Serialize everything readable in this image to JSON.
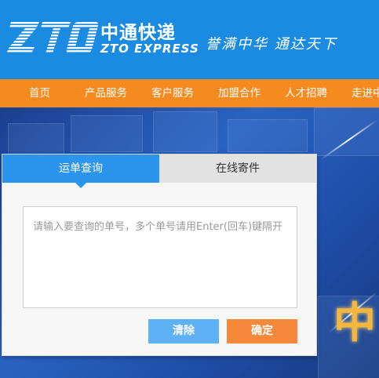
{
  "header": {
    "logo_mark": "ZTO",
    "logo_cn": "中通快递",
    "logo_en": "ZTO EXPRESS",
    "slogan": "誉满中华  通达天下",
    "bg_color": "#1a8be0"
  },
  "nav": {
    "bg_color": "#f58a1f",
    "items": [
      {
        "label": "首页"
      },
      {
        "label": "产品服务"
      },
      {
        "label": "客户服务"
      },
      {
        "label": "加盟合作"
      },
      {
        "label": "人才招聘"
      },
      {
        "label": "走进中"
      }
    ]
  },
  "banner": {
    "gold_text": "中"
  },
  "query_panel": {
    "tabs": [
      {
        "label": "运单查询",
        "active": true
      },
      {
        "label": "在线寄件",
        "active": false
      }
    ],
    "textarea_placeholder": "请输入要查询的单号，多个单号请用Enter(回车)键隔开",
    "clear_label": "清除",
    "confirm_label": "确定",
    "accent": "#2b95ee",
    "confirm_color": "#f5883b"
  }
}
